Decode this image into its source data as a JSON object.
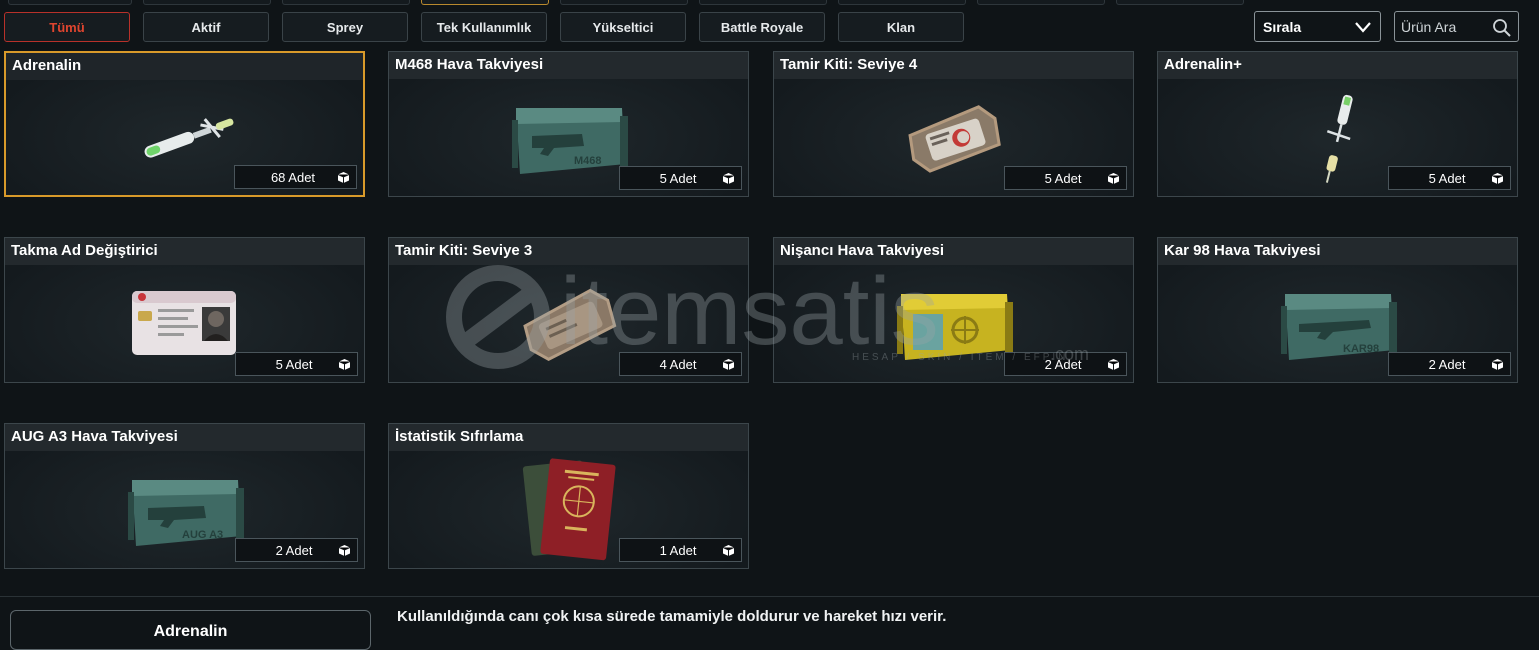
{
  "filter_tabs": [
    {
      "label": "Tümü",
      "active": true
    },
    {
      "label": "Aktif",
      "active": false
    },
    {
      "label": "Sprey",
      "active": false
    },
    {
      "label": "Tek Kullanımlık",
      "active": false
    },
    {
      "label": "Yükseltici",
      "active": false
    },
    {
      "label": "Battle Royale",
      "active": false
    },
    {
      "label": "Klan",
      "active": false
    }
  ],
  "sort": {
    "label": "Sırala",
    "icon": "chevron-down-icon"
  },
  "search": {
    "placeholder": "Ürün Ara",
    "value": "",
    "icon": "search-icon"
  },
  "items": [
    {
      "title": "Adrenalin",
      "qty": "68 Adet",
      "icon": "adrenaline-syringe",
      "selected": true
    },
    {
      "title": "M468 Hava Takviyesi",
      "qty": "5 Adet",
      "icon": "supply-crate-m468"
    },
    {
      "title": "Tamir Kiti: Seviye 4",
      "qty": "5 Adet",
      "icon": "repair-kit-level-4"
    },
    {
      "title": "Adrenalin+",
      "qty": "5 Adet",
      "icon": "adrenaline-plus-syringe"
    },
    {
      "title": "Takma Ad Değiştirici",
      "qty": "5 Adet",
      "icon": "id-card"
    },
    {
      "title": "Tamir Kiti: Seviye 3",
      "qty": "4 Adet",
      "icon": "repair-kit-level-3"
    },
    {
      "title": "Nişancı Hava Takviyesi",
      "qty": "2 Adet",
      "icon": "sniper-supply-crate"
    },
    {
      "title": "Kar 98 Hava Takviyesi",
      "qty": "2 Adet",
      "icon": "supply-crate-kar98"
    },
    {
      "title": "AUG A3 Hava Takviyesi",
      "qty": "2 Adet",
      "icon": "supply-crate-aug-a3"
    },
    {
      "title": "İstatistik Sıfırlama",
      "qty": "1 Adet",
      "icon": "passport"
    }
  ],
  "watermark": {
    "brand": "itemsatis",
    "tagline": "HESAP / SKIN / ITEM / EFPIN",
    "suffix": ".com"
  },
  "detail": {
    "button_label": "Adrenalin",
    "description": "Kullanıldığında canı çok kısa sürede tamamiyle doldurur ve hareket hızı verir."
  },
  "colors": {
    "accent_active_tab": "#e0452f",
    "selected_border": "#d89a2a",
    "background": "#0f1417"
  }
}
